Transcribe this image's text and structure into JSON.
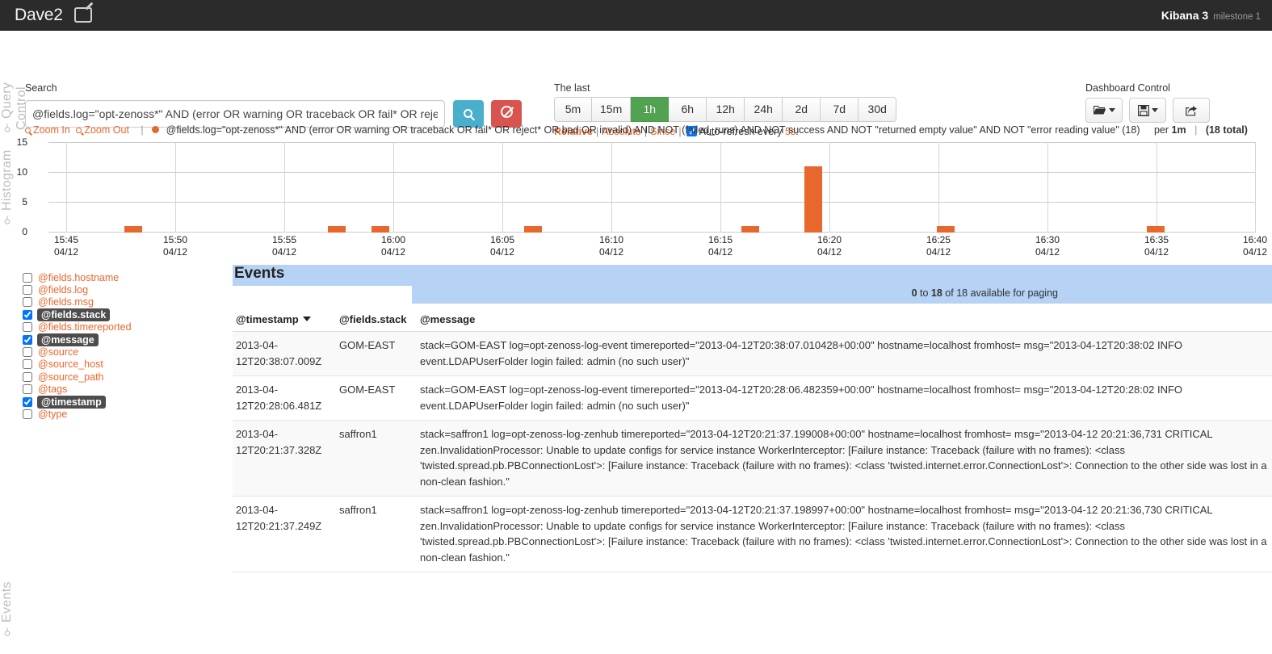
{
  "navbar": {
    "dashboard_title": "Dave2",
    "edit_icon": "pencil-square-icon",
    "kibana_name": "Kibana 3",
    "kibana_milestone": "milestone 1"
  },
  "rails": {
    "query_control": "Query Control",
    "histogram": "Histogram",
    "events": "Events",
    "pin_icon": "pin-icon"
  },
  "query": {
    "label": "Search",
    "value": "@fields.log=\"opt-zenoss*\" AND (error OR warning OR traceback OR fail* OR reje",
    "placeholder": "",
    "search_button": "search-icon",
    "clear_button": "ban-icon"
  },
  "time": {
    "label": "The last",
    "ranges": [
      "5m",
      "15m",
      "1h",
      "6h",
      "12h",
      "24h",
      "2d",
      "7d",
      "30d"
    ],
    "active_range": "1h",
    "modes": [
      "Relative",
      "Absolute",
      "Since"
    ],
    "active_mode": "Relative",
    "autorefresh_prefix": "Auto-refresh every ",
    "autorefresh_value": "5s",
    "autorefresh_suffix": ".",
    "autorefresh_checked": true
  },
  "dashboard_control": {
    "label": "Dashboard Control",
    "buttons": [
      {
        "name": "load-dashboard-button",
        "icon": "folder-open-icon",
        "caret": true
      },
      {
        "name": "save-dashboard-button",
        "icon": "floppy-disk-icon",
        "caret": true
      },
      {
        "name": "share-dashboard-button",
        "icon": "share-export-icon",
        "caret": false
      }
    ]
  },
  "histogram": {
    "zoom_in": "Zoom In",
    "zoom_out": "Zoom Out",
    "legend_query": "@fields.log=\"opt-zenoss*\" AND (error OR warning OR traceback OR fail* OR reject* OR bad OR invalid) AND NOT (failed_runs) AND NOT success AND NOT \"returned empty value\" AND NOT \"error reading value\"",
    "legend_count": "(18)",
    "interval_prefix": "per ",
    "interval": "1m",
    "total": "(18 total)",
    "series_color": "#e8672c"
  },
  "chart_data": {
    "type": "bar",
    "title": "",
    "xlabel": "",
    "ylabel": "",
    "ylim": [
      0,
      15
    ],
    "yticks": [
      0,
      5,
      10,
      15
    ],
    "grid": true,
    "legend_position": "top",
    "interval": "1m",
    "xtick_labels": [
      {
        "time": "15:45",
        "date": "04/12"
      },
      {
        "time": "15:50",
        "date": "04/12"
      },
      {
        "time": "15:55",
        "date": "04/12"
      },
      {
        "time": "16:00",
        "date": "04/12"
      },
      {
        "time": "16:05",
        "date": "04/12"
      },
      {
        "time": "16:10",
        "date": "04/12"
      },
      {
        "time": "16:15",
        "date": "04/12"
      },
      {
        "time": "16:20",
        "date": "04/12"
      },
      {
        "time": "16:25",
        "date": "04/12"
      },
      {
        "time": "16:30",
        "date": "04/12"
      },
      {
        "time": "16:35",
        "date": "04/12"
      },
      {
        "time": "16:40",
        "date": "04/12"
      }
    ],
    "x": [
      "15:48",
      "15:59",
      "16:01",
      "16:08",
      "16:18",
      "16:21",
      "16:28",
      "16:38"
    ],
    "values": [
      1,
      1,
      1,
      1,
      1,
      11,
      1,
      1
    ],
    "series": [
      {
        "name": "@fields.log=\"opt-zenoss*\" AND (error OR warning OR traceback OR fail* OR reject* OR bad OR invalid) AND NOT (failed_runs) AND NOT success AND NOT \"returned empty value\" AND NOT \"error reading value\"",
        "color": "#e8672c",
        "values": [
          1,
          1,
          1,
          1,
          1,
          11,
          1,
          1
        ]
      }
    ]
  },
  "fields": {
    "items": [
      {
        "name": "@fields.hostname",
        "selected": false
      },
      {
        "name": "@fields.log",
        "selected": false
      },
      {
        "name": "@fields.msg",
        "selected": false
      },
      {
        "name": "@fields.stack",
        "selected": true
      },
      {
        "name": "@fields.timereported",
        "selected": false
      },
      {
        "name": "@message",
        "selected": true
      },
      {
        "name": "@source",
        "selected": false
      },
      {
        "name": "@source_host",
        "selected": false
      },
      {
        "name": "@source_path",
        "selected": false
      },
      {
        "name": "@tags",
        "selected": false
      },
      {
        "name": "@timestamp",
        "selected": true
      },
      {
        "name": "@type",
        "selected": false
      }
    ]
  },
  "events": {
    "title": "Events",
    "paging": {
      "from": "0",
      "to_word": " to ",
      "to": "18",
      "suffix": " of 18 available for paging"
    },
    "columns": [
      "@timestamp",
      "@fields.stack",
      "@message"
    ],
    "sort_column": "@timestamp",
    "sort_direction": "desc",
    "rows": [
      {
        "timestamp": "2013-04-12T20:38:07.009Z",
        "stack": "GOM-EAST",
        "message": "stack=GOM-EAST log=opt-zenoss-log-event timereported=\"2013-04-12T20:38:07.010428+00:00\" hostname=localhost fromhost= msg=\"2013-04-12T20:38:02 INFO event.LDAPUserFolder login failed: admin (no such user)\""
      },
      {
        "timestamp": "2013-04-12T20:28:06.481Z",
        "stack": "GOM-EAST",
        "message": "stack=GOM-EAST log=opt-zenoss-log-event timereported=\"2013-04-12T20:28:06.482359+00:00\" hostname=localhost fromhost= msg=\"2013-04-12T20:28:02 INFO event.LDAPUserFolder login failed: admin (no such user)\""
      },
      {
        "timestamp": "2013-04-12T20:21:37.328Z",
        "stack": "saffron1",
        "message": "stack=saffron1 log=opt-zenoss-log-zenhub timereported=\"2013-04-12T20:21:37.199008+00:00\" hostname=localhost fromhost= msg=\"2013-04-12 20:21:36,731 CRITICAL zen.InvalidationProcessor: Unable to update configs for service instance WorkerInterceptor: [Failure instance: Traceback (failure with no frames): <class 'twisted.spread.pb.PBConnectionLost'>: [Failure instance: Traceback (failure with no frames): <class 'twisted.internet.error.ConnectionLost'>: Connection to the other side was lost in a non-clean fashion.\""
      },
      {
        "timestamp": "2013-04-12T20:21:37.249Z",
        "stack": "saffron1",
        "message": "stack=saffron1 log=opt-zenoss-log-zenhub timereported=\"2013-04-12T20:21:37.198997+00:00\" hostname=localhost fromhost= msg=\"2013-04-12 20:21:36,730 CRITICAL zen.InvalidationProcessor: Unable to update configs for service instance WorkerInterceptor: [Failure instance: Traceback (failure with no frames): <class 'twisted.spread.pb.PBConnectionLost'>: [Failure instance: Traceback (failure with no frames): <class 'twisted.internet.error.ConnectionLost'>: Connection to the other side was lost in a non-clean fashion.\""
      }
    ]
  }
}
